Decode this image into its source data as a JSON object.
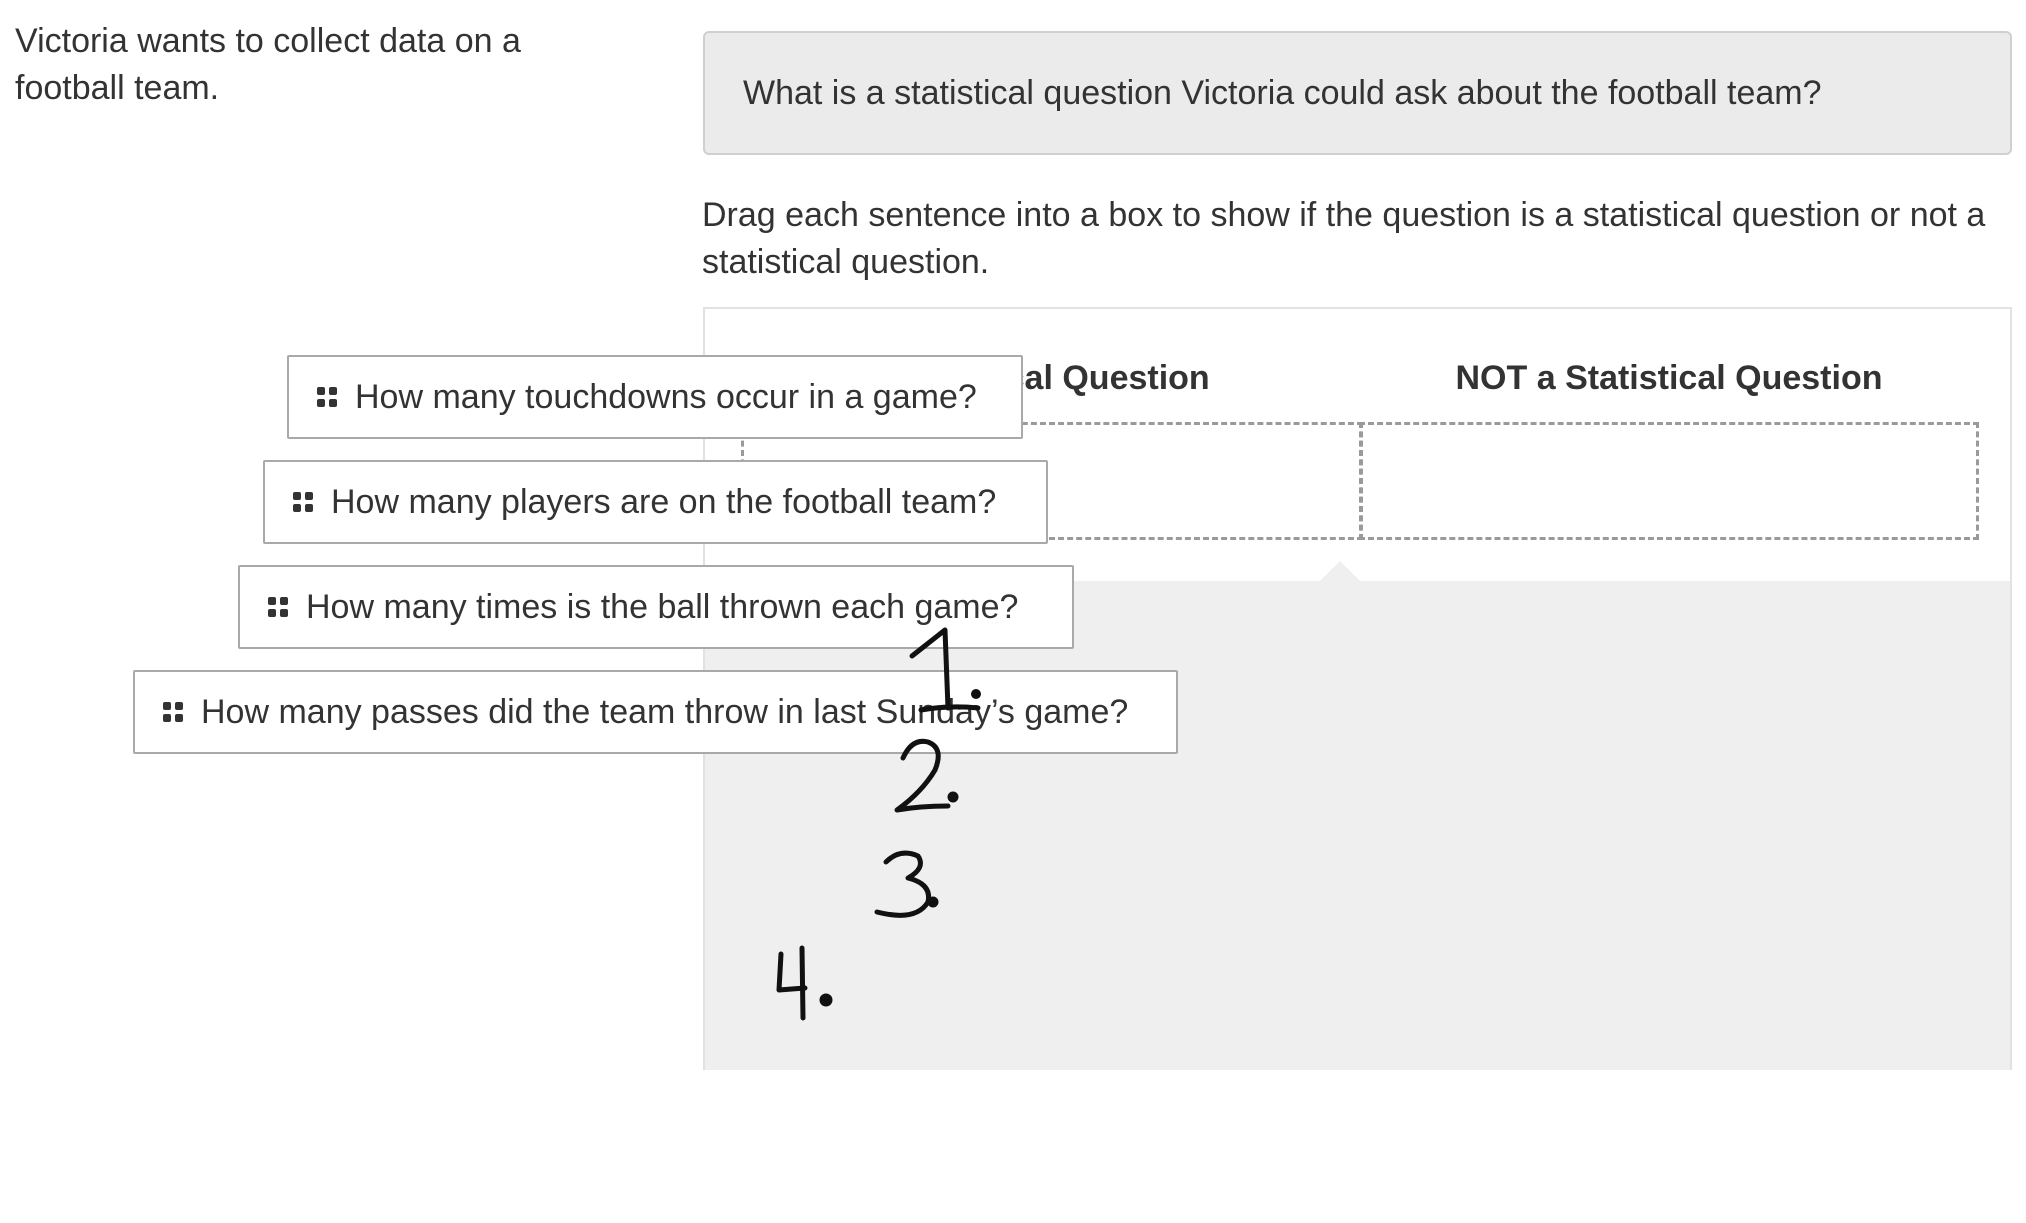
{
  "context": {
    "text": "Victoria wants to collect data on a football team."
  },
  "prompt": {
    "text": "What is a statistical question Victoria could ask about the football team?"
  },
  "instructions": {
    "text": "Drag each sentence into a box to show if the question is a statistical question or not a statistical question."
  },
  "sort": {
    "columns": [
      {
        "label": "Statistical Question"
      },
      {
        "label": "NOT a Statistical Question"
      }
    ],
    "cards": [
      {
        "label": "How many touchdowns occur in a game?",
        "handwritten_number": "1."
      },
      {
        "label": "How many players are on the football team?",
        "handwritten_number": "2."
      },
      {
        "label": "How many times is the ball thrown each game?",
        "handwritten_number": "3."
      },
      {
        "label": "How many passes did the team throw in last Sunday’s game?",
        "handwritten_number": "4."
      }
    ],
    "drag_handle_icon": "grip-dots-icon"
  },
  "colors": {
    "text": "#333333",
    "prompt_background": "#ebebeb",
    "pool_background": "#efefef",
    "dashed_border": "#9a9a9a",
    "handwriting": "#111111"
  }
}
